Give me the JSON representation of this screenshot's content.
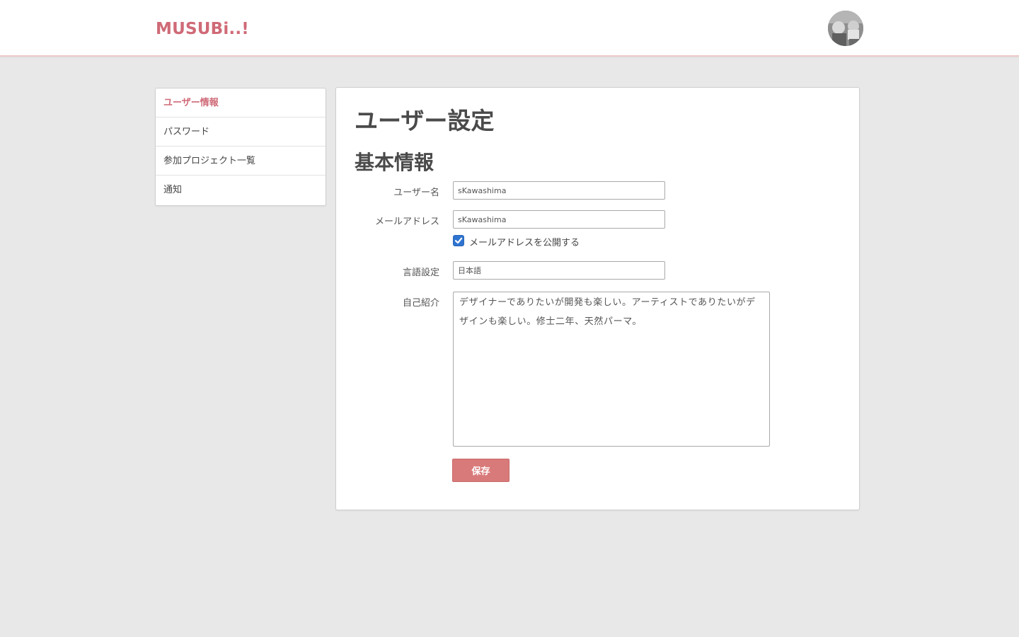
{
  "header": {
    "logo": "MUSUBi..!",
    "avatar_icon": "user-avatar"
  },
  "sidebar": {
    "items": [
      {
        "label": "ユーザー情報",
        "active": true
      },
      {
        "label": "パスワード",
        "active": false
      },
      {
        "label": "参加プロジェクト一覧",
        "active": false
      },
      {
        "label": "通知",
        "active": false
      }
    ]
  },
  "main": {
    "title": "ユーザー設定",
    "section_title": "基本情報",
    "fields": {
      "username": {
        "label": "ユーザー名",
        "value": "sKawashima"
      },
      "email": {
        "label": "メールアドレス",
        "value": "sKawashima"
      },
      "email_public": {
        "label": "メールアドレスを公開する",
        "checked": true
      },
      "language": {
        "label": "言語設定",
        "value": "日本語"
      },
      "bio": {
        "label": "自己紹介",
        "value": "デザイナーでありたいが開発も楽しい。アーティストでありたいがデザインも楽しい。修士二年、天然パーマ。"
      }
    },
    "save_label": "保存"
  },
  "colors": {
    "accent": "#cf6a77",
    "button": "#d97a7a",
    "background": "#e8e8e8",
    "checkbox": "#2f74d0"
  }
}
